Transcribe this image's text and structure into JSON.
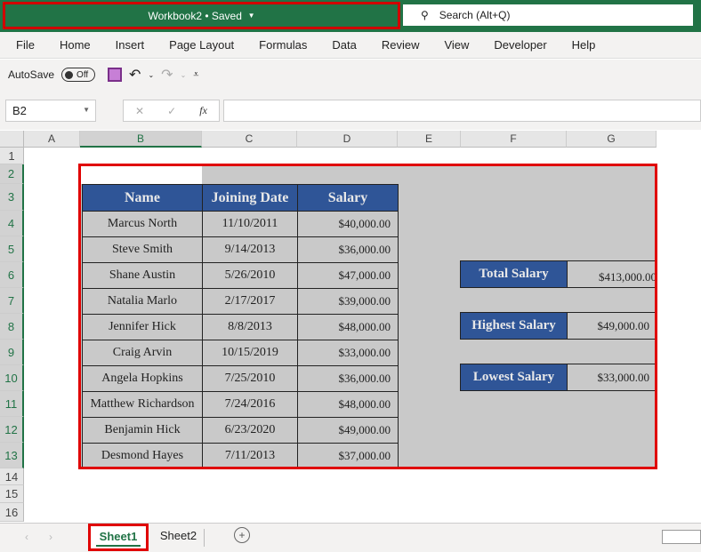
{
  "titlebar": {
    "title": "Workbook2 • Saved",
    "search_placeholder": "Search (Alt+Q)"
  },
  "menu": [
    "File",
    "Home",
    "Insert",
    "Page Layout",
    "Formulas",
    "Data",
    "Review",
    "View",
    "Developer",
    "Help"
  ],
  "qat": {
    "autosave_label": "AutoSave",
    "toggle_state": "Off"
  },
  "formula_bar": {
    "name_box": "B2",
    "fx": "fx",
    "formula": ""
  },
  "columns": [
    "A",
    "B",
    "C",
    "D",
    "E",
    "F",
    "G"
  ],
  "rows": [
    "1",
    "2",
    "3",
    "4",
    "5",
    "6",
    "7",
    "8",
    "9",
    "10",
    "11",
    "12",
    "13",
    "14",
    "15",
    "16"
  ],
  "table": {
    "headers": [
      "Name",
      "Joining Date",
      "Salary"
    ],
    "rows": [
      [
        "Marcus North",
        "11/10/2011",
        "$40,000.00"
      ],
      [
        "Steve Smith",
        "9/14/2013",
        "$36,000.00"
      ],
      [
        "Shane Austin",
        "5/26/2010",
        "$47,000.00"
      ],
      [
        "Natalia Marlo",
        "2/17/2017",
        "$39,000.00"
      ],
      [
        "Jennifer Hick",
        "8/8/2013",
        "$48,000.00"
      ],
      [
        "Craig Arvin",
        "10/15/2019",
        "$33,000.00"
      ],
      [
        "Angela Hopkins",
        "7/25/2010",
        "$36,000.00"
      ],
      [
        "Matthew Richardson",
        "7/24/2016",
        "$48,000.00"
      ],
      [
        "Benjamin Hick",
        "6/23/2020",
        "$49,000.00"
      ],
      [
        "Desmond Hayes",
        "7/11/2013",
        "$37,000.00"
      ]
    ]
  },
  "summary": [
    {
      "label": "Total Salary",
      "value": "$413,000.00"
    },
    {
      "label": "Highest Salary",
      "value": "$49,000.00"
    },
    {
      "label": "Lowest Salary",
      "value": "$33,000.00"
    }
  ],
  "sheets": [
    "Sheet1",
    "Sheet2"
  ],
  "colors": {
    "accent": "#217346",
    "header_blue": "#2f5597",
    "highlight": "#e00000"
  }
}
